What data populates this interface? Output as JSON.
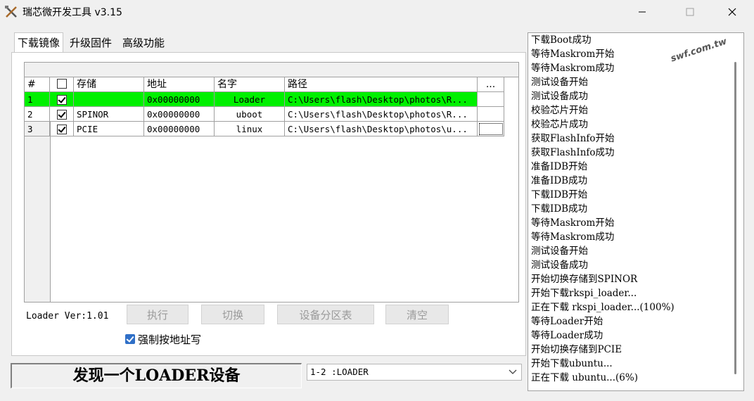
{
  "window": {
    "title": "瑞芯微开发工具 v3.15"
  },
  "tabs": [
    "下载镜像",
    "升级固件",
    "高级功能"
  ],
  "table": {
    "headers": [
      "#",
      "",
      "存储",
      "地址",
      "名字",
      "路径",
      "..."
    ],
    "rows": [
      {
        "num": "1",
        "checked": true,
        "storage": "",
        "address": "0x00000000",
        "name": "Loader",
        "path": "C:\\Users\\flash\\Desktop\\photos\\R..."
      },
      {
        "num": "2",
        "checked": true,
        "storage": "SPINOR",
        "address": "0x00000000",
        "name": "uboot",
        "path": "C:\\Users\\flash\\Desktop\\photos\\R..."
      },
      {
        "num": "3",
        "checked": true,
        "storage": "PCIE",
        "address": "0x00000000",
        "name": "linux",
        "path": "C:\\Users\\flash\\Desktop\\photos\\u..."
      }
    ]
  },
  "loader_version": "Loader Ver:1.01",
  "buttons": {
    "run": "执行",
    "switch": "切换",
    "partition": "设备分区表",
    "clear": "清空"
  },
  "force_write": {
    "label": "强制按地址写",
    "checked": true
  },
  "status_text": "发现一个LOADER设备",
  "device_select": {
    "value": "1-2  :LOADER"
  },
  "watermark": "swf.com.tw",
  "log": [
    "下载Boot成功",
    "等待Maskrom开始",
    "等待Maskrom成功",
    "测试设备开始",
    "测试设备成功",
    "校验芯片开始",
    "校验芯片成功",
    "获取FlashInfo开始",
    "获取FlashInfo成功",
    "准备IDB开始",
    "准备IDB成功",
    "下载IDB开始",
    "下载IDB成功",
    "等待Maskrom开始",
    "等待Maskrom成功",
    "测试设备开始",
    "测试设备成功",
    "开始切换存储到SPINOR",
    "开始下载rkspi_loader...",
    "正在下载 rkspi_loader...(100%)",
    "等待Loader开始",
    "等待Loader成功",
    "开始切换存储到PCIE",
    "开始下载ubuntu...",
    "正在下载 ubuntu...(6%)"
  ]
}
